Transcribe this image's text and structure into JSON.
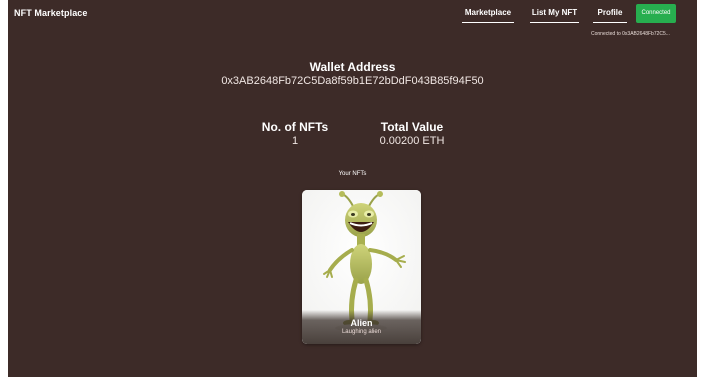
{
  "navbar": {
    "brand": "NFT Marketplace",
    "links": [
      "Marketplace",
      "List My NFT",
      "Profile"
    ],
    "connect_label": "Connected",
    "connected_to": "Connected to 0x3AB2648Fb72C5..."
  },
  "profile": {
    "wallet_title": "Wallet Address",
    "wallet_address": "0x3AB2648Fb72C5Da8f59b1E72bDdF043B85f94F50",
    "nft_count_label": "No. of NFTs",
    "nft_count_value": "1",
    "total_value_label": "Total Value",
    "total_value_value": "0.00200 ETH",
    "your_nfts_label": "Your NFTs"
  },
  "nfts": [
    {
      "name": "Alien",
      "description": "Laughing alien"
    }
  ],
  "colors": {
    "background": "#3d2b28",
    "connected_button": "#27ae4f",
    "card": "#ffffff"
  }
}
